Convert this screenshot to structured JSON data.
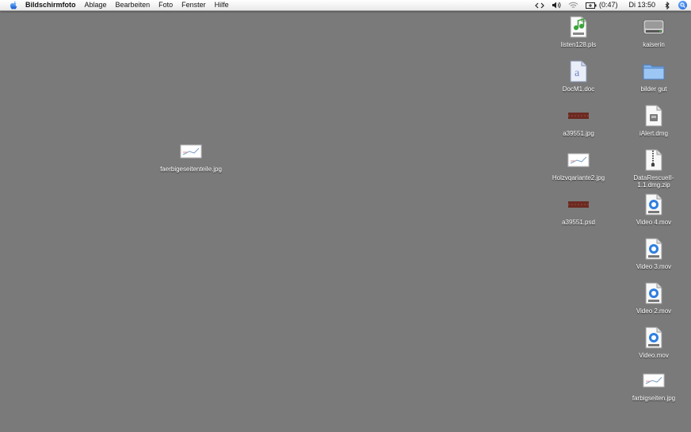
{
  "menubar": {
    "app_name": "Bildschirmfoto",
    "menus": [
      "Ablage",
      "Bearbeiten",
      "Foto",
      "Fenster",
      "Hilfe"
    ],
    "battery": "(0:47)",
    "clock": "Di 13:50"
  },
  "desktop": {
    "icons": [
      {
        "label": "listen128.pls",
        "icon": "playlist-file-icon"
      },
      {
        "label": "kaiserin",
        "icon": "hard-drive-icon"
      },
      {
        "label": "DocM1.doc",
        "icon": "word-document-icon"
      },
      {
        "label": "bilder gut",
        "icon": "folder-icon"
      },
      {
        "label": "a39551.jpg",
        "icon": "jpeg-thumbnail-icon"
      },
      {
        "label": "iAlert.dmg",
        "icon": "disk-image-icon"
      },
      {
        "label": "Holzvqariante2.jpg",
        "icon": "jpeg-thumbnail-icon"
      },
      {
        "label": "DataRescueII-1.1.dmg.zip",
        "icon": "zip-archive-icon"
      },
      {
        "label": "a39551.psd",
        "icon": "psd-thumbnail-icon"
      },
      {
        "label": "Video 4.mov",
        "icon": "quicktime-movie-icon"
      },
      {
        "label": "Video 3.mov",
        "icon": "quicktime-movie-icon"
      },
      {
        "label": "Video 2.mov",
        "icon": "quicktime-movie-icon"
      },
      {
        "label": "Video.mov",
        "icon": "quicktime-movie-icon"
      },
      {
        "label": "farbigseiten.jpg",
        "icon": "jpeg-thumbnail-icon"
      },
      {
        "label": "faerbigeseitenteile.jpg",
        "icon": "jpeg-thumbnail-icon"
      }
    ]
  },
  "colors": {
    "desktop_background": "#7a7a7a",
    "menubar": "#f2f2f2",
    "label_text": "#ffffff",
    "accent_blue": "#1b5ed6"
  }
}
